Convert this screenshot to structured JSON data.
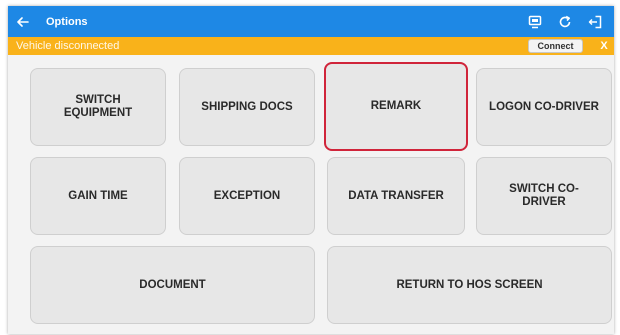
{
  "appbar": {
    "back_icon": "arrow-left-icon",
    "title": "Options",
    "actions": [
      "screen-share-icon",
      "refresh-icon",
      "logout-icon"
    ],
    "color": "#1e88e5"
  },
  "banner": {
    "message": "Vehicle disconnected",
    "connect_label": "Connect",
    "dismiss_label": "X",
    "color": "#f9b21a"
  },
  "options": {
    "switch_equipment": "SWITCH\nEQUIPMENT",
    "shipping_docs": "SHIPPING DOCS",
    "remark": "REMARK",
    "logon_co_driver": "LOGON CO-DRIVER",
    "gain_time": "GAIN TIME",
    "exception": "EXCEPTION",
    "data_transfer": "DATA TRANSFER",
    "switch_co_driver": "SWITCH CO-\nDRIVER",
    "document": "DOCUMENT",
    "return_to_hos": "RETURN TO HOS SCREEN"
  },
  "selected_option": "REMARK",
  "highlight_color": "#d0243a"
}
